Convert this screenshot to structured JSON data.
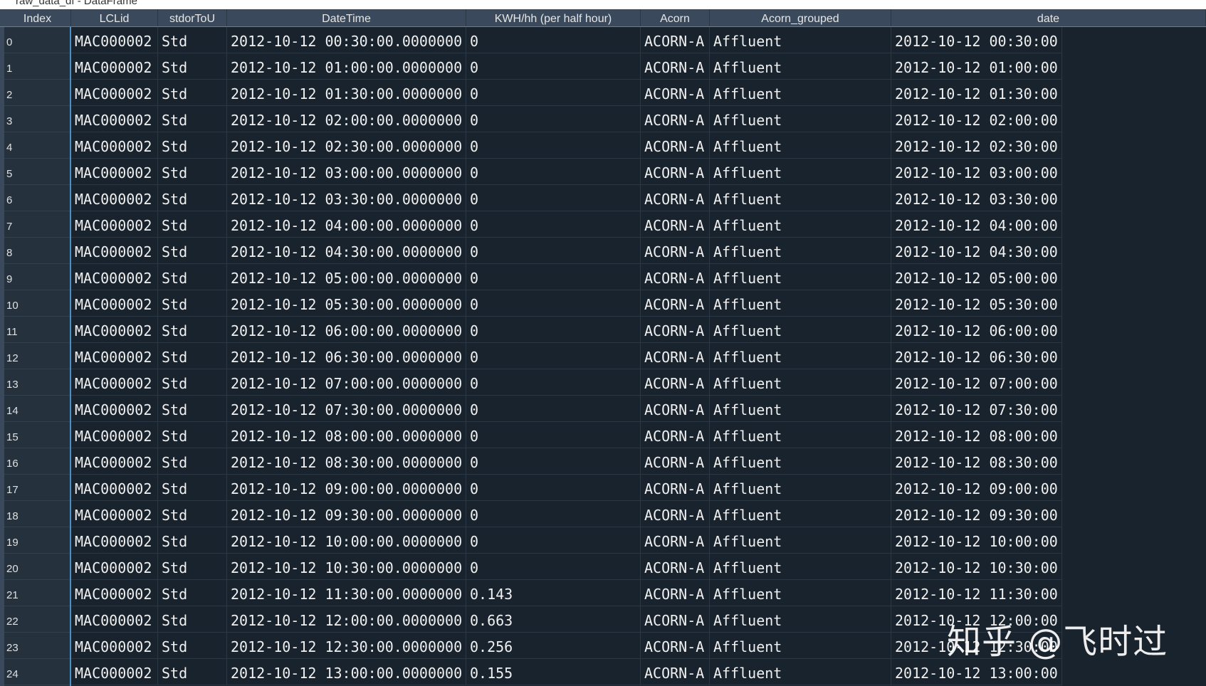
{
  "window": {
    "title": "raw_data_df - DataFrame"
  },
  "table": {
    "headers": [
      "Index",
      "LCLid",
      "stdorToU",
      "DateTime",
      "KWH/hh (per half hour)",
      "Acorn",
      "Acorn_grouped",
      "date"
    ],
    "rows": [
      {
        "index": "0",
        "lclid": "MAC000002",
        "stdortou": "Std",
        "datetime": "2012-10-12 00:30:00.0000000",
        "kwh": "0",
        "acorn": "ACORN-A",
        "acorn_grouped": "Affluent",
        "date": "2012-10-12 00:30:00"
      },
      {
        "index": "1",
        "lclid": "MAC000002",
        "stdortou": "Std",
        "datetime": "2012-10-12 01:00:00.0000000",
        "kwh": "0",
        "acorn": "ACORN-A",
        "acorn_grouped": "Affluent",
        "date": "2012-10-12 01:00:00"
      },
      {
        "index": "2",
        "lclid": "MAC000002",
        "stdortou": "Std",
        "datetime": "2012-10-12 01:30:00.0000000",
        "kwh": "0",
        "acorn": "ACORN-A",
        "acorn_grouped": "Affluent",
        "date": "2012-10-12 01:30:00"
      },
      {
        "index": "3",
        "lclid": "MAC000002",
        "stdortou": "Std",
        "datetime": "2012-10-12 02:00:00.0000000",
        "kwh": "0",
        "acorn": "ACORN-A",
        "acorn_grouped": "Affluent",
        "date": "2012-10-12 02:00:00"
      },
      {
        "index": "4",
        "lclid": "MAC000002",
        "stdortou": "Std",
        "datetime": "2012-10-12 02:30:00.0000000",
        "kwh": "0",
        "acorn": "ACORN-A",
        "acorn_grouped": "Affluent",
        "date": "2012-10-12 02:30:00"
      },
      {
        "index": "5",
        "lclid": "MAC000002",
        "stdortou": "Std",
        "datetime": "2012-10-12 03:00:00.0000000",
        "kwh": "0",
        "acorn": "ACORN-A",
        "acorn_grouped": "Affluent",
        "date": "2012-10-12 03:00:00"
      },
      {
        "index": "6",
        "lclid": "MAC000002",
        "stdortou": "Std",
        "datetime": "2012-10-12 03:30:00.0000000",
        "kwh": "0",
        "acorn": "ACORN-A",
        "acorn_grouped": "Affluent",
        "date": "2012-10-12 03:30:00"
      },
      {
        "index": "7",
        "lclid": "MAC000002",
        "stdortou": "Std",
        "datetime": "2012-10-12 04:00:00.0000000",
        "kwh": "0",
        "acorn": "ACORN-A",
        "acorn_grouped": "Affluent",
        "date": "2012-10-12 04:00:00"
      },
      {
        "index": "8",
        "lclid": "MAC000002",
        "stdortou": "Std",
        "datetime": "2012-10-12 04:30:00.0000000",
        "kwh": "0",
        "acorn": "ACORN-A",
        "acorn_grouped": "Affluent",
        "date": "2012-10-12 04:30:00"
      },
      {
        "index": "9",
        "lclid": "MAC000002",
        "stdortou": "Std",
        "datetime": "2012-10-12 05:00:00.0000000",
        "kwh": "0",
        "acorn": "ACORN-A",
        "acorn_grouped": "Affluent",
        "date": "2012-10-12 05:00:00"
      },
      {
        "index": "10",
        "lclid": "MAC000002",
        "stdortou": "Std",
        "datetime": "2012-10-12 05:30:00.0000000",
        "kwh": "0",
        "acorn": "ACORN-A",
        "acorn_grouped": "Affluent",
        "date": "2012-10-12 05:30:00"
      },
      {
        "index": "11",
        "lclid": "MAC000002",
        "stdortou": "Std",
        "datetime": "2012-10-12 06:00:00.0000000",
        "kwh": "0",
        "acorn": "ACORN-A",
        "acorn_grouped": "Affluent",
        "date": "2012-10-12 06:00:00"
      },
      {
        "index": "12",
        "lclid": "MAC000002",
        "stdortou": "Std",
        "datetime": "2012-10-12 06:30:00.0000000",
        "kwh": "0",
        "acorn": "ACORN-A",
        "acorn_grouped": "Affluent",
        "date": "2012-10-12 06:30:00"
      },
      {
        "index": "13",
        "lclid": "MAC000002",
        "stdortou": "Std",
        "datetime": "2012-10-12 07:00:00.0000000",
        "kwh": "0",
        "acorn": "ACORN-A",
        "acorn_grouped": "Affluent",
        "date": "2012-10-12 07:00:00"
      },
      {
        "index": "14",
        "lclid": "MAC000002",
        "stdortou": "Std",
        "datetime": "2012-10-12 07:30:00.0000000",
        "kwh": "0",
        "acorn": "ACORN-A",
        "acorn_grouped": "Affluent",
        "date": "2012-10-12 07:30:00"
      },
      {
        "index": "15",
        "lclid": "MAC000002",
        "stdortou": "Std",
        "datetime": "2012-10-12 08:00:00.0000000",
        "kwh": "0",
        "acorn": "ACORN-A",
        "acorn_grouped": "Affluent",
        "date": "2012-10-12 08:00:00"
      },
      {
        "index": "16",
        "lclid": "MAC000002",
        "stdortou": "Std",
        "datetime": "2012-10-12 08:30:00.0000000",
        "kwh": "0",
        "acorn": "ACORN-A",
        "acorn_grouped": "Affluent",
        "date": "2012-10-12 08:30:00"
      },
      {
        "index": "17",
        "lclid": "MAC000002",
        "stdortou": "Std",
        "datetime": "2012-10-12 09:00:00.0000000",
        "kwh": "0",
        "acorn": "ACORN-A",
        "acorn_grouped": "Affluent",
        "date": "2012-10-12 09:00:00"
      },
      {
        "index": "18",
        "lclid": "MAC000002",
        "stdortou": "Std",
        "datetime": "2012-10-12 09:30:00.0000000",
        "kwh": "0",
        "acorn": "ACORN-A",
        "acorn_grouped": "Affluent",
        "date": "2012-10-12 09:30:00"
      },
      {
        "index": "19",
        "lclid": "MAC000002",
        "stdortou": "Std",
        "datetime": "2012-10-12 10:00:00.0000000",
        "kwh": "0",
        "acorn": "ACORN-A",
        "acorn_grouped": "Affluent",
        "date": "2012-10-12 10:00:00"
      },
      {
        "index": "20",
        "lclid": "MAC000002",
        "stdortou": "Std",
        "datetime": "2012-10-12 10:30:00.0000000",
        "kwh": "0",
        "acorn": "ACORN-A",
        "acorn_grouped": "Affluent",
        "date": "2012-10-12 10:30:00"
      },
      {
        "index": "21",
        "lclid": "MAC000002",
        "stdortou": "Std",
        "datetime": "2012-10-12 11:30:00.0000000",
        "kwh": "0.143",
        "acorn": "ACORN-A",
        "acorn_grouped": "Affluent",
        "date": "2012-10-12 11:30:00"
      },
      {
        "index": "22",
        "lclid": "MAC000002",
        "stdortou": "Std",
        "datetime": "2012-10-12 12:00:00.0000000",
        "kwh": "0.663",
        "acorn": "ACORN-A",
        "acorn_grouped": "Affluent",
        "date": "2012-10-12 12:00:00"
      },
      {
        "index": "23",
        "lclid": "MAC000002",
        "stdortou": "Std",
        "datetime": "2012-10-12 12:30:00.0000000",
        "kwh": "0.256",
        "acorn": "ACORN-A",
        "acorn_grouped": "Affluent",
        "date": "2012-10-12 12:30:00"
      },
      {
        "index": "24",
        "lclid": "MAC000002",
        "stdortou": "Std",
        "datetime": "2012-10-12 13:00:00.0000000",
        "kwh": "0.155",
        "acorn": "ACORN-A",
        "acorn_grouped": "Affluent",
        "date": "2012-10-12 13:00:00"
      }
    ]
  },
  "watermark": {
    "text": "知乎 @飞时过"
  },
  "colors": {
    "background": "#19232d",
    "header_bg": "#3a4a5c",
    "index_col_bg": "#25313d",
    "grid_line": "#2b3745",
    "accent_border": "#4a90c8",
    "text": "#f0f0f0"
  }
}
